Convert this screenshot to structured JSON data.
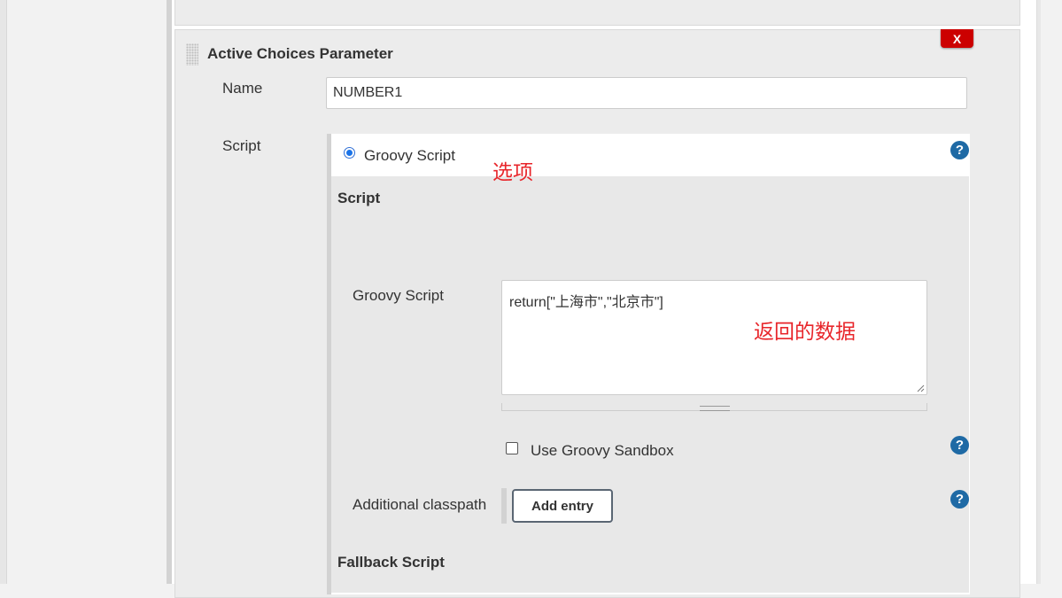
{
  "parameter": {
    "title": "Active Choices Parameter",
    "delete_label": "X",
    "name_label": "Name",
    "name_value": "NUMBER1",
    "script_label": "Script"
  },
  "script_section": {
    "radio_label": "Groovy Script",
    "radio_selected": true,
    "option_annotation": "选项",
    "script_heading": "Script",
    "groovy_script_label": "Groovy Script",
    "groovy_script_value": "return[\"上海市\",\"北京市\"]",
    "data_annotation": "返回的数据",
    "sandbox_label": "Use Groovy Sandbox",
    "sandbox_checked": false,
    "classpath_label": "Additional classpath",
    "add_entry_label": "Add entry",
    "fallback_heading": "Fallback Script"
  },
  "help_icon_text": "?",
  "colors": {
    "delete_button": "#cc0000",
    "help_icon": "#1f6aa5",
    "annotation": "#e8262b",
    "radio": "#1a73e8"
  }
}
